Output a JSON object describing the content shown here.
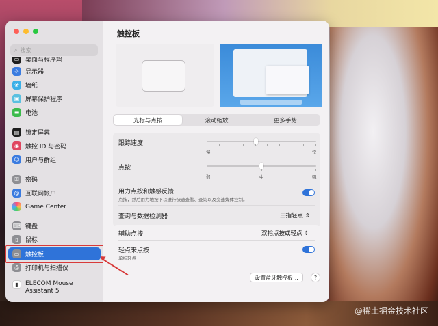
{
  "window": {
    "title": "触控板"
  },
  "sidebar": {
    "search_placeholder": "搜索",
    "items": [
      {
        "label": "桌面与程序坞",
        "icon": "dock-icon",
        "color": "#1e1e1e"
      },
      {
        "label": "显示器",
        "icon": "display-icon",
        "color": "#3a7be0"
      },
      {
        "label": "墙纸",
        "icon": "wallpaper-icon",
        "color": "#3ab0e8"
      },
      {
        "label": "屏幕保护程序",
        "icon": "screensaver-icon",
        "color": "#5bc0e0"
      },
      {
        "label": "电池",
        "icon": "battery-icon",
        "color": "#3cbb4c"
      },
      {
        "label": "锁定屏幕",
        "icon": "lock-screen-icon",
        "color": "#1e1e1e"
      },
      {
        "label": "触控 ID 与密码",
        "icon": "touch-id-icon",
        "color": "#e0465f"
      },
      {
        "label": "用户与群组",
        "icon": "users-icon",
        "color": "#3a7be0"
      },
      {
        "label": "密码",
        "icon": "passwords-icon",
        "color": "#8e8e93"
      },
      {
        "label": "互联网帐户",
        "icon": "internet-accounts-icon",
        "color": "#3a7be0"
      },
      {
        "label": "Game Center",
        "icon": "game-center-icon",
        "color": "#ffffff"
      },
      {
        "label": "键盘",
        "icon": "keyboard-icon",
        "color": "#8e8e93"
      },
      {
        "label": "鼠标",
        "icon": "mouse-icon",
        "color": "#8e8e93"
      },
      {
        "label": "触控板",
        "icon": "trackpad-icon",
        "color": "#8e8e93"
      },
      {
        "label": "打印机与扫描仪",
        "icon": "printer-icon",
        "color": "#8e8e93"
      },
      {
        "label": "ELECOM Mouse Assistant 5",
        "icon": "elecom-icon",
        "color": "#ffffff"
      }
    ]
  },
  "tabs": [
    "光标与点按",
    "滚动缩放",
    "更多手势"
  ],
  "settings": {
    "tracking_speed": {
      "label": "跟踪速度",
      "min_label": "慢",
      "max_label": "快",
      "value": 0.45
    },
    "click": {
      "label": "点按",
      "labels": [
        "弱",
        "中",
        "强"
      ],
      "value": 0.5
    },
    "force_click": {
      "label": "用力点按和触感反馈",
      "desc": "点按，然后用力地按下以进行快速查看、查询以及变速媒体控制。",
      "enabled": true
    },
    "lookup": {
      "label": "查询与数据检测器",
      "value": "三指轻点"
    },
    "secondary_click": {
      "label": "辅助点按",
      "value": "双指点按或轻点"
    },
    "tap_to_click": {
      "label": "轻点来点按",
      "desc": "单指轻点",
      "enabled": true
    }
  },
  "buttons": {
    "bluetooth": "设置蓝牙触控板...",
    "help": "?"
  },
  "watermark": "@稀土掘金技术社区",
  "accent_color": "#2f73d9",
  "highlight_color": "#d83a3a"
}
